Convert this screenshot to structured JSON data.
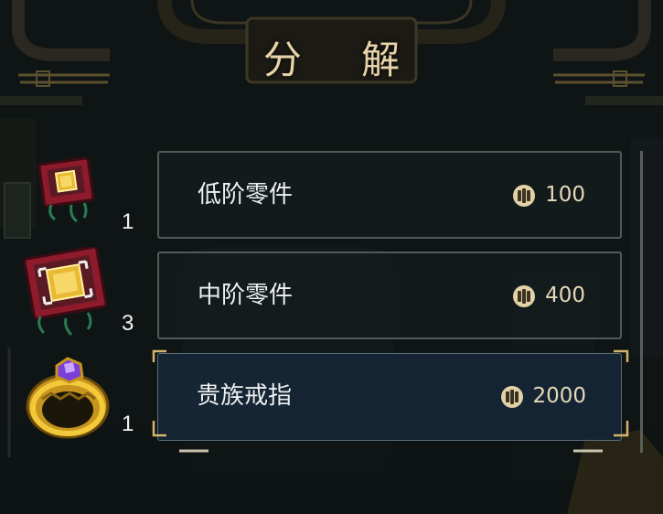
{
  "title": "分 解",
  "items": [
    {
      "name": "低阶零件",
      "qty": "1",
      "price": "100",
      "icon": "low-tier-chip-icon",
      "selected": false
    },
    {
      "name": "中阶零件",
      "qty": "3",
      "price": "400",
      "icon": "mid-tier-chip-icon",
      "selected": false
    },
    {
      "name": "贵族戒指",
      "qty": "1",
      "price": "2000",
      "icon": "noble-ring-icon",
      "selected": true
    }
  ],
  "colors": {
    "gold": "#d4b46a",
    "panel": "#141c1e",
    "selected": "#16263a"
  }
}
